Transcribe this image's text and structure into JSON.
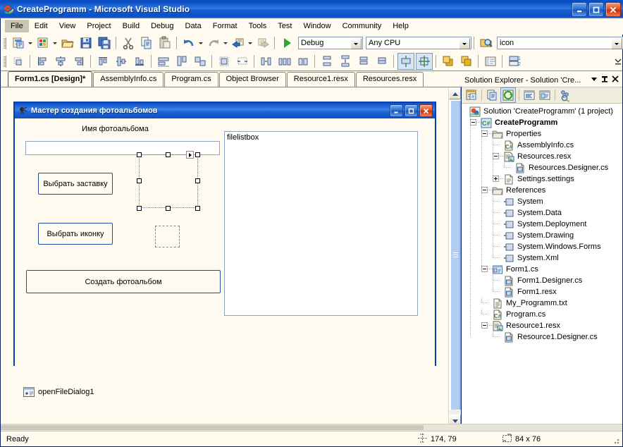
{
  "window": {
    "title": "CreateProgramm - Microsoft Visual Studio",
    "app_icon": "visual-studio-icon",
    "minimize_label": "_",
    "maximize_label": "□",
    "close_label": "✕"
  },
  "menubar": {
    "items": [
      {
        "label": "File",
        "active": true
      },
      {
        "label": "Edit",
        "active": false
      },
      {
        "label": "View",
        "active": false
      },
      {
        "label": "Project",
        "active": false
      },
      {
        "label": "Build",
        "active": false
      },
      {
        "label": "Debug",
        "active": false
      },
      {
        "label": "Data",
        "active": false
      },
      {
        "label": "Format",
        "active": false
      },
      {
        "label": "Tools",
        "active": false
      },
      {
        "label": "Test",
        "active": false
      },
      {
        "label": "Window",
        "active": false
      },
      {
        "label": "Community",
        "active": false
      },
      {
        "label": "Help",
        "active": false
      }
    ]
  },
  "standard_toolbar": {
    "icons": [
      "new-project-icon",
      "add-new-item-icon",
      "open-file-icon",
      "save-icon",
      "save-all-icon",
      "cut-icon",
      "copy-icon",
      "paste-icon",
      "undo-icon",
      "redo-icon",
      "navigate-backward-icon",
      "navigate-forward-icon",
      "start-debugging-icon"
    ],
    "config_combo": {
      "value": "Debug",
      "name": "solution-configurations"
    },
    "platform_combo": {
      "value": "Any CPU",
      "name": "solution-platforms"
    },
    "find_icon": "find-in-files-icon",
    "find_combo": {
      "value": "icon",
      "name": "find-combo"
    },
    "overflow_label": "»"
  },
  "layout_toolbar": {
    "icons": [
      "align-lefts-icon",
      "align-centers-icon",
      "align-rights-icon",
      "align-tops-icon",
      "align-middles-icon",
      "align-bottoms-icon",
      "make-same-width-icon",
      "make-same-height-icon",
      "make-same-size-icon",
      "size-to-grid-icon",
      "horizontal-spacing-make-equal-icon",
      "horizontal-spacing-increase-icon",
      "horizontal-spacing-decrease-icon",
      "horizontal-spacing-remove-icon",
      "vertical-spacing-make-equal-icon",
      "vertical-spacing-increase-icon",
      "vertical-spacing-decrease-icon",
      "vertical-spacing-remove-icon",
      "center-horizontally-icon",
      "center-vertically-icon",
      "bring-to-front-icon",
      "send-to-back-icon",
      "tab-order-icon",
      "table-layout-icon"
    ],
    "overflow_label": "»"
  },
  "document_tabs": {
    "items": [
      {
        "label": "Form1.cs [Design]*",
        "active": true
      },
      {
        "label": "AssemblyInfo.cs",
        "active": false
      },
      {
        "label": "Program.cs",
        "active": false
      },
      {
        "label": "Object Browser",
        "active": false
      },
      {
        "label": "Resource1.resx",
        "active": false
      },
      {
        "label": "Resources.resx",
        "active": false
      }
    ],
    "dropdown_label": "▼",
    "close_label": "✕"
  },
  "designer": {
    "form": {
      "title": "Мастер создания фотоальбомов",
      "icon": "form-app-icon",
      "minimize_label": "_",
      "maximize_label": "❐",
      "close_label": "✕",
      "controls": {
        "name_label": "Имя фотоальбома",
        "name_textbox_value": "",
        "button_splash": "Выбрать заставку",
        "button_icon": "Выбрать иконку",
        "button_create": "Создать фотоальбом",
        "listbox_item": "filelistbox",
        "selected_control": "pictureBox",
        "small_picturebox": "pictureBox-small"
      }
    },
    "component_tray": [
      {
        "label": "openFileDialog1",
        "icon": "open-file-dialog-icon"
      }
    ],
    "scrollbar": {
      "up_label": "▲",
      "down_label": "▼"
    }
  },
  "solution_explorer": {
    "title": "Solution Explorer - Solution 'Cre...",
    "dropdown_label": "▼",
    "pin_label": "⊥",
    "close_label": "✕",
    "toolbar_icons": [
      "properties-window-icon",
      "show-all-files-icon",
      "refresh-icon",
      "view-code-icon",
      "view-designer-icon",
      "object-browser-icon"
    ],
    "tree": [
      {
        "label": "Solution 'CreateProgramm' (1 project)",
        "depth": 0,
        "icon": "solution-icon",
        "expander": "none",
        "bold": false
      },
      {
        "label": "CreateProgramm",
        "depth": 1,
        "icon": "csharp-project-icon",
        "expander": "minus",
        "bold": true
      },
      {
        "label": "Properties",
        "depth": 2,
        "icon": "folder-icon",
        "expander": "minus",
        "bold": false
      },
      {
        "label": "AssemblyInfo.cs",
        "depth": 3,
        "icon": "csharp-file-icon",
        "expander": "none",
        "bold": false
      },
      {
        "label": "Resources.resx",
        "depth": 3,
        "icon": "resx-file-icon",
        "expander": "minus",
        "bold": false
      },
      {
        "label": "Resources.Designer.cs",
        "depth": 4,
        "icon": "designer-file-icon",
        "expander": "none",
        "bold": false
      },
      {
        "label": "Settings.settings",
        "depth": 3,
        "icon": "settings-file-icon",
        "expander": "plus",
        "bold": false
      },
      {
        "label": "References",
        "depth": 2,
        "icon": "folder-icon",
        "expander": "minus",
        "bold": false
      },
      {
        "label": "System",
        "depth": 3,
        "icon": "reference-icon",
        "expander": "none",
        "bold": false
      },
      {
        "label": "System.Data",
        "depth": 3,
        "icon": "reference-icon",
        "expander": "none",
        "bold": false
      },
      {
        "label": "System.Deployment",
        "depth": 3,
        "icon": "reference-icon",
        "expander": "none",
        "bold": false
      },
      {
        "label": "System.Drawing",
        "depth": 3,
        "icon": "reference-icon",
        "expander": "none",
        "bold": false
      },
      {
        "label": "System.Windows.Forms",
        "depth": 3,
        "icon": "reference-icon",
        "expander": "none",
        "bold": false
      },
      {
        "label": "System.Xml",
        "depth": 3,
        "icon": "reference-icon",
        "expander": "none",
        "bold": false
      },
      {
        "label": "Form1.cs",
        "depth": 2,
        "icon": "form-file-icon",
        "expander": "minus",
        "bold": false
      },
      {
        "label": "Form1.Designer.cs",
        "depth": 3,
        "icon": "designer-file-icon",
        "expander": "none",
        "bold": false
      },
      {
        "label": "Form1.resx",
        "depth": 3,
        "icon": "designer-file-icon",
        "expander": "none",
        "bold": false
      },
      {
        "label": "My_Programm.txt",
        "depth": 2,
        "icon": "text-file-icon",
        "expander": "none",
        "bold": false
      },
      {
        "label": "Program.cs",
        "depth": 2,
        "icon": "csharp-file-icon",
        "expander": "none",
        "bold": false
      },
      {
        "label": "Resource1.resx",
        "depth": 2,
        "icon": "resx-file-icon",
        "expander": "minus",
        "bold": false
      },
      {
        "label": "Resource1.Designer.cs",
        "depth": 3,
        "icon": "designer-file-icon",
        "expander": "none",
        "bold": false
      }
    ]
  },
  "statusbar": {
    "status": "Ready",
    "position": "174, 79",
    "position_icon": "cursor-position-icon",
    "size": "84 x 76",
    "size_icon": "selection-size-icon"
  },
  "colors": {
    "titlebar_blue": "#1862d2",
    "chrome_bg": "#fffbf0",
    "form_border": "#0a3fa8",
    "accent_select": "#d6e4f4"
  }
}
